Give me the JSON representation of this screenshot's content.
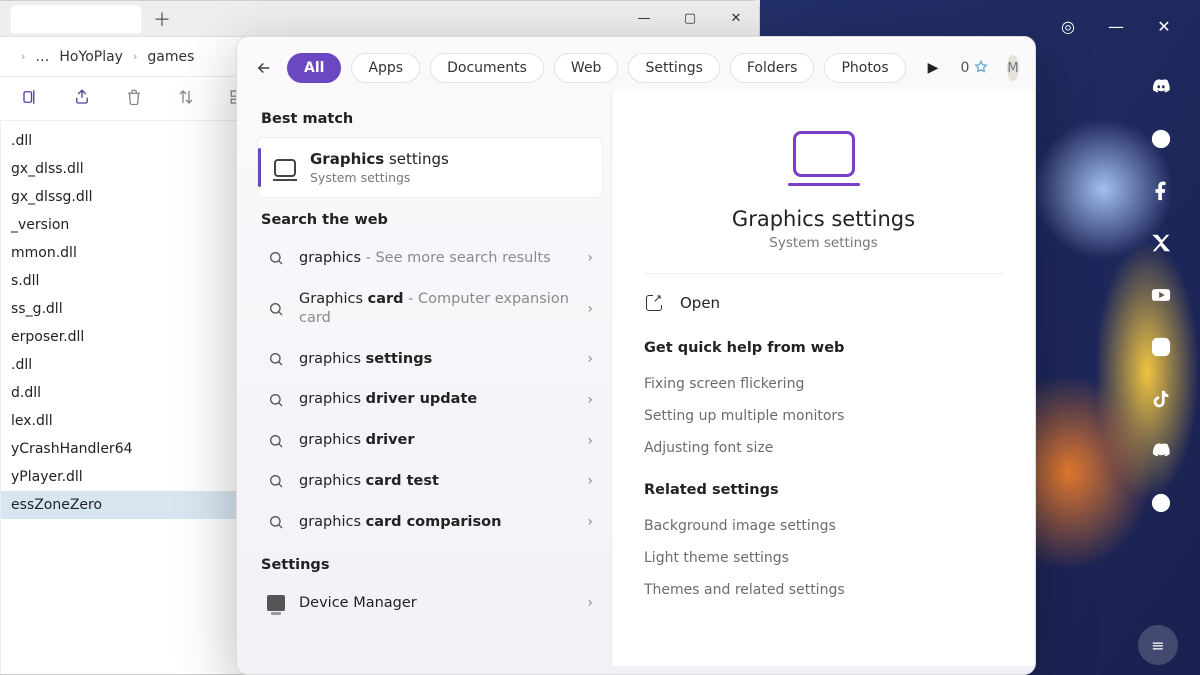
{
  "explorer": {
    "new_tab_glyph": "＋",
    "win_min": "—",
    "win_max": "▢",
    "win_close": "✕",
    "crumb_up_glyph": "›",
    "crumb_more": "…",
    "crumb1": "HoYoPlay",
    "crumb2": "games",
    "nav_collapse_glyph": "˄",
    "files": [
      ".dll",
      "gx_dlss.dll",
      "gx_dlssg.dll",
      "_version",
      "mmon.dll",
      "s.dll",
      "ss_g.dll",
      "erposer.dll",
      ".dll",
      "d.dll",
      "lex.dll",
      "yCrashHandler64",
      "yPlayer.dll",
      "essZoneZero"
    ],
    "selected_index": 13
  },
  "desktop": {
    "ctrl_target": "◎",
    "ctrl_min": "—",
    "ctrl_close": "✕",
    "bottom_glyph": "≡"
  },
  "search": {
    "tabs": [
      "All",
      "Apps",
      "Documents",
      "Web",
      "Settings",
      "Folders",
      "Photos"
    ],
    "active_tab_index": 0,
    "play_glyph": "▶",
    "points": "0",
    "avatar_letter": "M",
    "more_glyph": "···",
    "sections": {
      "best_match": "Best match",
      "search_web": "Search the web",
      "settings": "Settings"
    },
    "match": {
      "title_bold": "Graphics",
      "title_rest": " settings",
      "subtitle": "System settings"
    },
    "web": [
      {
        "pre": "graphics",
        "bold": "",
        "hint": " - See more search results",
        "multiline": false
      },
      {
        "pre": "Graphics ",
        "bold": "card",
        "hint": " - Computer expansion card",
        "multiline": true
      },
      {
        "pre": "graphics ",
        "bold": "settings",
        "hint": "",
        "multiline": false
      },
      {
        "pre": "graphics ",
        "bold": "driver update",
        "hint": "",
        "multiline": false
      },
      {
        "pre": "graphics ",
        "bold": "driver",
        "hint": "",
        "multiline": false
      },
      {
        "pre": "graphics ",
        "bold": "card test",
        "hint": "",
        "multiline": false
      },
      {
        "pre": "graphics ",
        "bold": "card comparison",
        "hint": "",
        "multiline": false
      }
    ],
    "settings_rows": [
      {
        "label": "Device Manager"
      }
    ],
    "preview": {
      "title": "Graphics settings",
      "subtitle": "System settings",
      "open": "Open",
      "help_header": "Get quick help from web",
      "help_links": [
        "Fixing screen flickering",
        "Setting up multiple monitors",
        "Adjusting font size"
      ],
      "related_header": "Related settings",
      "related_links": [
        "Background image settings",
        "Light theme settings",
        "Themes and related settings"
      ]
    }
  }
}
